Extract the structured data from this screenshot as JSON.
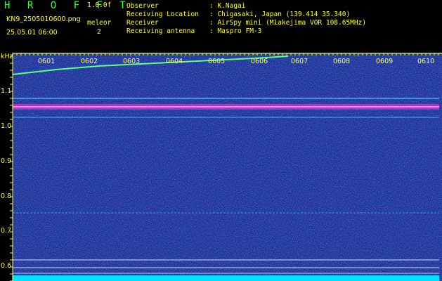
{
  "app": {
    "title": "H R O F F T",
    "version": "1.0.0f"
  },
  "file": {
    "name": "KN9_2505010600.png",
    "datetime": "25.05.01 06:00"
  },
  "meteor": {
    "label": "meleor",
    "count": "2"
  },
  "info": [
    {
      "key": "Observer",
      "value": ": K.Nagai"
    },
    {
      "key": "Receiving Location",
      "value": ": Chigasaki, Japan (139.414 35.340)"
    },
    {
      "key": "Receiver",
      "value": ": AirSpy mini (Miakejima VOR 108.65MHz)"
    },
    {
      "key": "Receiving antenna",
      "value": ": Maspro FM-3"
    }
  ],
  "axis": {
    "unit": "kHz",
    "y_ticks": [
      "1.1",
      "1.0",
      "0.9",
      "0.8",
      "0.7",
      "0.6"
    ],
    "time_ticks": [
      "0601",
      "0602",
      "0603",
      "0604",
      "0605",
      "0606",
      "0607",
      "0608",
      "0609",
      "0610"
    ]
  },
  "colors": {
    "text": "#ffff40",
    "title": "#30ff30",
    "background": "#1c2488",
    "carrier": "#40d0ff"
  }
}
